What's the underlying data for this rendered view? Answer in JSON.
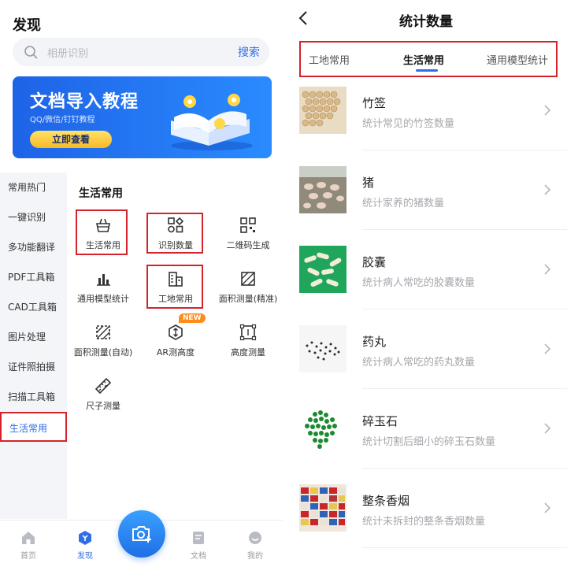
{
  "left": {
    "title": "发现",
    "search": {
      "placeholder": "相册识别",
      "button": "搜索"
    },
    "banner": {
      "title": "文档导入教程",
      "subtitle": "QQ/微信/钉钉教程",
      "button": "立即查看"
    },
    "sidebar": {
      "items": [
        {
          "label": "常用热门"
        },
        {
          "label": "一键识别"
        },
        {
          "label": "多功能翻译"
        },
        {
          "label": "PDF工具箱"
        },
        {
          "label": "CAD工具箱"
        },
        {
          "label": "图片处理"
        },
        {
          "label": "证件照拍摄"
        },
        {
          "label": "扫描工具箱"
        },
        {
          "label": "生活常用",
          "active": true
        }
      ]
    },
    "section": {
      "title": "生活常用",
      "items": [
        {
          "label": "生活常用",
          "icon": "basket-icon"
        },
        {
          "label": "识别数量",
          "icon": "shapes-icon"
        },
        {
          "label": "二维码生成",
          "icon": "qrcode-icon"
        },
        {
          "label": "通用模型统计",
          "icon": "bar-chart-icon"
        },
        {
          "label": "工地常用",
          "icon": "building-icon"
        },
        {
          "label": "面积测量(精准)",
          "icon": "area-icon"
        },
        {
          "label": "面积测量(自动)",
          "icon": "area-auto-icon"
        },
        {
          "label": "AR测高度",
          "icon": "ar-height-icon",
          "badge": "NEW"
        },
        {
          "label": "高度测量",
          "icon": "height-icon"
        },
        {
          "label": "尺子测量",
          "icon": "ruler-icon"
        }
      ]
    },
    "tabbar": {
      "items": [
        {
          "label": "首页",
          "icon": "home-icon"
        },
        {
          "label": "发现",
          "icon": "discover-icon",
          "active": true
        },
        {
          "label": "文档",
          "icon": "document-icon"
        },
        {
          "label": "我的",
          "icon": "profile-icon"
        }
      ]
    },
    "colors": {
      "accent": "#2f6ee6",
      "highlight": "#d4232a"
    }
  },
  "right": {
    "title": "统计数量",
    "tabs": [
      {
        "label": "工地常用"
      },
      {
        "label": "生活常用",
        "active": true
      },
      {
        "label": "通用模型统计"
      }
    ],
    "items": [
      {
        "name": "竹签",
        "desc": "统计常见的竹签数量",
        "thumb": "bamboo-sticks"
      },
      {
        "name": "猪",
        "desc": "统计家养的猪数量",
        "thumb": "pigs"
      },
      {
        "name": "胶囊",
        "desc": "统计病人常吃的胶囊数量",
        "thumb": "capsules"
      },
      {
        "name": "药丸",
        "desc": "统计病人常吃的药丸数量",
        "thumb": "pills"
      },
      {
        "name": "碎玉石",
        "desc": "统计切割后细小的碎玉石数量",
        "thumb": "jade-stones"
      },
      {
        "name": "整条香烟",
        "desc": "统计未拆封的整条香烟数量",
        "thumb": "cigarette-cartons"
      }
    ]
  }
}
